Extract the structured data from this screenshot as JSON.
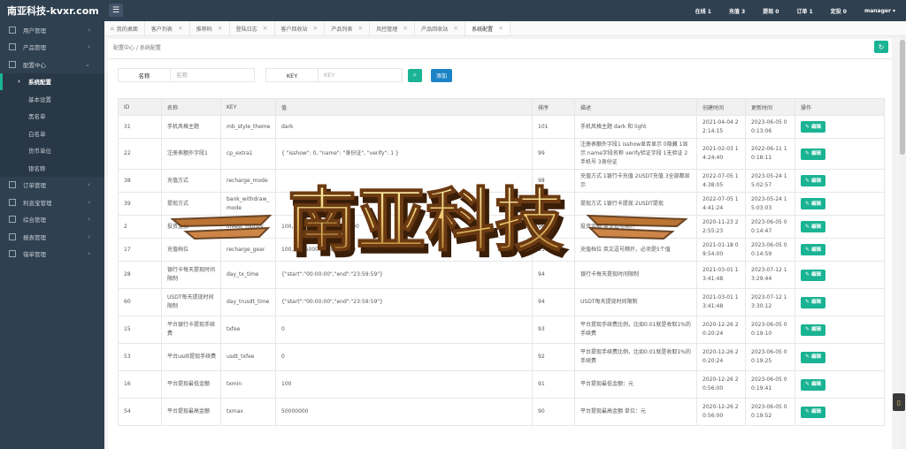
{
  "app": {
    "title": "南亚科技-kvxr.com",
    "top_stats": [
      "在线 1",
      "充值 3",
      "提现 0",
      "订单 1",
      "定投 0",
      "manager ▾"
    ]
  },
  "sidebar": {
    "items": [
      {
        "label": "用户管理",
        "type": "group",
        "arrow": "‹"
      },
      {
        "label": "产品管理",
        "type": "group",
        "arrow": "‹"
      },
      {
        "label": "配置中心",
        "type": "group-open",
        "arrow": "⌄"
      },
      {
        "label": "系统配置",
        "type": "sub-active"
      },
      {
        "label": "基本设置",
        "type": "sub"
      },
      {
        "label": "黑名单",
        "type": "sub"
      },
      {
        "label": "白名单",
        "type": "sub"
      },
      {
        "label": "货币单位",
        "type": "sub"
      },
      {
        "label": "银名称",
        "type": "sub"
      },
      {
        "label": "订单管理",
        "type": "group",
        "arrow": "‹"
      },
      {
        "label": "利息宝管理",
        "type": "group",
        "arrow": "‹"
      },
      {
        "label": "综合管理",
        "type": "group",
        "arrow": "‹"
      },
      {
        "label": "报表管理",
        "type": "group",
        "arrow": "‹"
      },
      {
        "label": "错单管理",
        "type": "group",
        "arrow": "‹"
      }
    ]
  },
  "tabs": [
    {
      "label": "我的桌面",
      "home": true
    },
    {
      "label": "客户列表"
    },
    {
      "label": "推荐码"
    },
    {
      "label": "登陆日志"
    },
    {
      "label": "客户回收站"
    },
    {
      "label": "产品列表"
    },
    {
      "label": "风控管理"
    },
    {
      "label": "产品回收站"
    },
    {
      "label": "系统配置",
      "active": true
    }
  ],
  "breadcrumb": "配置中心  /  系统配置",
  "search": {
    "name_label": "名称",
    "name_placeholder": "名称",
    "key_label": "KEY",
    "key_placeholder": "KEY",
    "add_label": "添加"
  },
  "table": {
    "headers": [
      "ID",
      "名称",
      "KEY",
      "值",
      "排序",
      "描述",
      "创建时间",
      "更新时间",
      "操作"
    ],
    "edit_label": "编辑",
    "rows": [
      {
        "id": "31",
        "name": "手机风格主题",
        "key": "mb_style_theme",
        "value": "dark",
        "sort": "101",
        "desc": "手机风格主题 dark 和 light",
        "created": "2021-04-04 22:14:15",
        "updated": "2023-06-05 00:13:06",
        "h": "r1"
      },
      {
        "id": "22",
        "name": "注册表额外字段1",
        "key": "cp_extra1",
        "value": "{ \"isshow\": 0, \"name\": \"身份证\", \"verify\": 1 }",
        "sort": "99",
        "desc": "注册表额外字段1 isshow显否显示 0隐藏 1显示 name字段名称 verify验证字段 1无验证 2手机号 3身份证",
        "created": "2021-02-03 14:24:40",
        "updated": "2022-06-11 10:18:11",
        "h": "r2"
      },
      {
        "id": "38",
        "name": "充值方式",
        "key": "recharge_mode",
        "value": "",
        "sort": "98",
        "desc": "充值方式 1银行卡充值 2USDT充值 3全部都显示",
        "created": "2022-07-05 14:38:05",
        "updated": "2023-05-24 15:02:57",
        "h": "r1"
      },
      {
        "id": "39",
        "name": "提现方式",
        "key": "bank_withdraw_mode",
        "value": "",
        "sort": "97",
        "desc": "提现方式 1银行卡提现 2USDT提现",
        "created": "2022-07-05 14:41:24",
        "updated": "2023-05-24 15:03:03",
        "h": "r1"
      },
      {
        "id": "2",
        "name": "投资金额",
        "key": "invest_money",
        "value": "100,1000,5000,10000,50000",
        "sort": "96",
        "desc": "投资金额 英文逗号隔开",
        "created": "2020-11-23 22:55:23",
        "updated": "2023-06-05 00:14:47",
        "h": "r1"
      },
      {
        "id": "17",
        "name": "充值档位",
        "key": "recharge_gear",
        "value": "100,500,5000,10000,50000",
        "sort": "95",
        "desc": "充值档位 英文逗号隔开，必须是5个值",
        "created": "2021-01-18 09:54:00",
        "updated": "2023-06-05 00:14:59",
        "h": "r1"
      },
      {
        "id": "28",
        "name": "银行卡每天提现时间限制",
        "key": "day_tx_time",
        "value": "{\"start\":\"00:00:00\",\"end\":\"23:59:59\"}",
        "sort": "94",
        "desc": "银行卡每天提现时间限制",
        "created": "2021-03-01 13:41:48",
        "updated": "2023-07-12 13:29:44",
        "h": "r2"
      },
      {
        "id": "60",
        "name": "USDT每天提现时间限制",
        "key": "day_trusdt_time",
        "value": "{\"start\":\"00:00:00\",\"end\":\"23:59:59\"}",
        "sort": "94",
        "desc": "USDT每天提现时间限制",
        "created": "2021-03-01 13:41:48",
        "updated": "2023-07-12 13:30:12",
        "h": "r2"
      },
      {
        "id": "15",
        "name": "平台银行卡提现手续费",
        "key": "txfee",
        "value": "0",
        "sort": "93",
        "desc": "平台提现手续费比例，比如0.01就是收取1%的手续费",
        "created": "2020-12-26 20:20:24",
        "updated": "2023-06-05 00:19:10",
        "h": "r2"
      },
      {
        "id": "53",
        "name": "平台usdt提现手续费",
        "key": "usdt_txfee",
        "value": "0",
        "sort": "92",
        "desc": "平台提现手续费比例，比如0.01就是收取1%的手续费",
        "created": "2020-12-26 20:20:24",
        "updated": "2023-06-05 00:19:25",
        "h": "r2"
      },
      {
        "id": "16",
        "name": "平台提现最低金额",
        "key": "txmin",
        "value": "100",
        "sort": "91",
        "desc": "平台提现最低金额：元",
        "created": "2020-12-26 20:56:00",
        "updated": "2023-06-05 00:19:41",
        "h": "r2"
      },
      {
        "id": "54",
        "name": "平台提现最高金额",
        "key": "txmax",
        "value": "50000000",
        "sort": "90",
        "desc": "平台提现最高金额 单位：元",
        "created": "2020-12-26 20:56:00",
        "updated": "2023-06-05 00:19:52",
        "h": "r2"
      }
    ]
  },
  "watermark": {
    "text": "南亚科技"
  },
  "colors": {
    "primary": "#1ab394",
    "info": "#1c84c6",
    "sidebar": "#2f4050",
    "sidebar_active": "#293846",
    "watermark_gold": "#e9c46a"
  }
}
